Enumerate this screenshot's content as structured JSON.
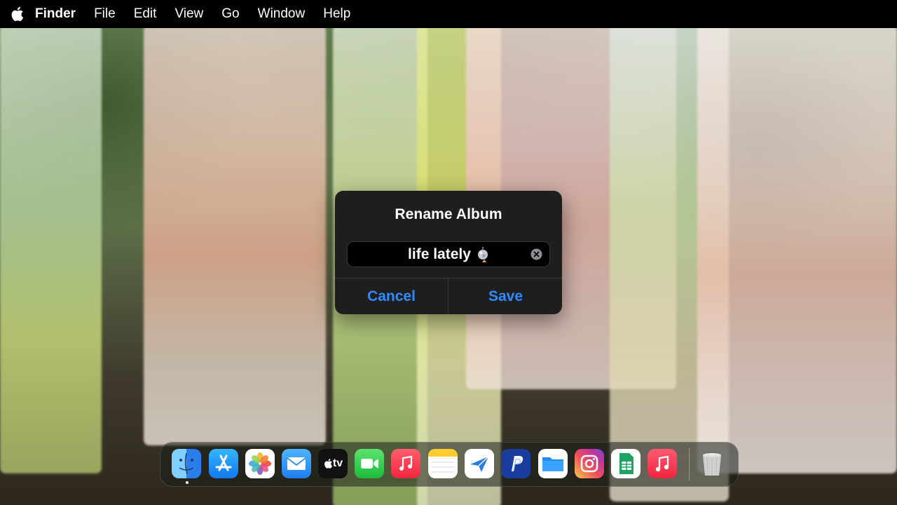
{
  "menubar": {
    "apple": "apple-logo-icon",
    "app_name": "Finder",
    "items": [
      "File",
      "Edit",
      "View",
      "Go",
      "Window",
      "Help"
    ]
  },
  "dialog": {
    "title": "Rename Album",
    "field_value": "life lately",
    "field_emoji": "disco-ball-icon",
    "cancel_label": "Cancel",
    "save_label": "Save",
    "accent": "#2f8cff"
  },
  "dock": {
    "apps": [
      "finder-icon",
      "app-store-icon",
      "photos-icon",
      "mail-icon",
      "apple-tv-icon",
      "facetime-icon",
      "music-icon",
      "notes-icon",
      "spark-mail-icon",
      "paypal-icon",
      "files-icon",
      "instagram-icon",
      "google-sheets-icon",
      "itunes-store-icon",
      "trash-icon"
    ],
    "tv_label": "tv"
  }
}
